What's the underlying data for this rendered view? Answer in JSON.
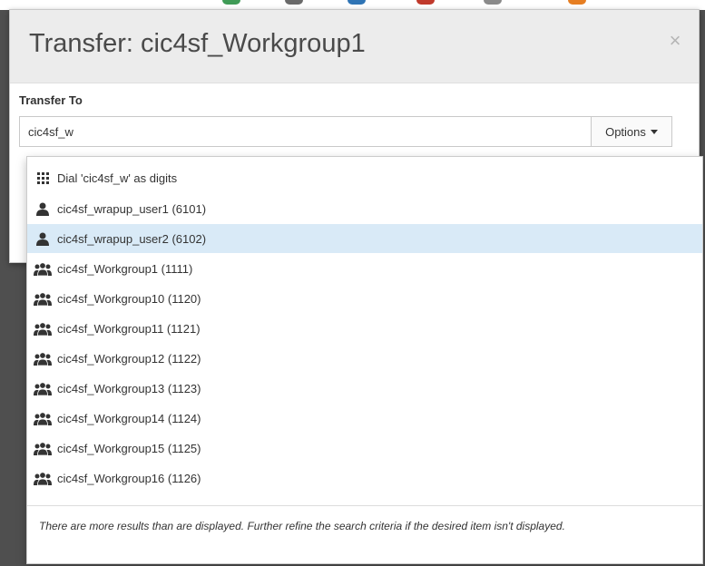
{
  "dialog": {
    "title": "Transfer: cic4sf_Workgroup1",
    "close_symbol": "×",
    "field_label": "Transfer To",
    "input_value": "cic4sf_w",
    "options_label": "Options"
  },
  "dropdown": {
    "items": [
      {
        "label": "Dial 'cic4sf_w' as digits",
        "icon": "grid-icon"
      },
      {
        "label": "cic4sf_wrapup_user1 (6101)",
        "icon": "user-icon"
      },
      {
        "label": "cic4sf_wrapup_user2 (6102)",
        "icon": "user-icon",
        "selected": true
      },
      {
        "label": "cic4sf_Workgroup1 (1111)",
        "icon": "users-icon"
      },
      {
        "label": "cic4sf_Workgroup10 (1120)",
        "icon": "users-icon"
      },
      {
        "label": "cic4sf_Workgroup11 (1121)",
        "icon": "users-icon"
      },
      {
        "label": "cic4sf_Workgroup12 (1122)",
        "icon": "users-icon"
      },
      {
        "label": "cic4sf_Workgroup13 (1123)",
        "icon": "users-icon"
      },
      {
        "label": "cic4sf_Workgroup14 (1124)",
        "icon": "users-icon"
      },
      {
        "label": "cic4sf_Workgroup15 (1125)",
        "icon": "users-icon"
      },
      {
        "label": "cic4sf_Workgroup16 (1126)",
        "icon": "users-icon"
      }
    ],
    "footer": "There are more results than are displayed. Further refine the search criteria if the desired item isn't displayed."
  },
  "colors": {
    "selected_row": "#d9eaf7",
    "header_background": "#ececec",
    "backdrop": "#4f4f4f"
  }
}
